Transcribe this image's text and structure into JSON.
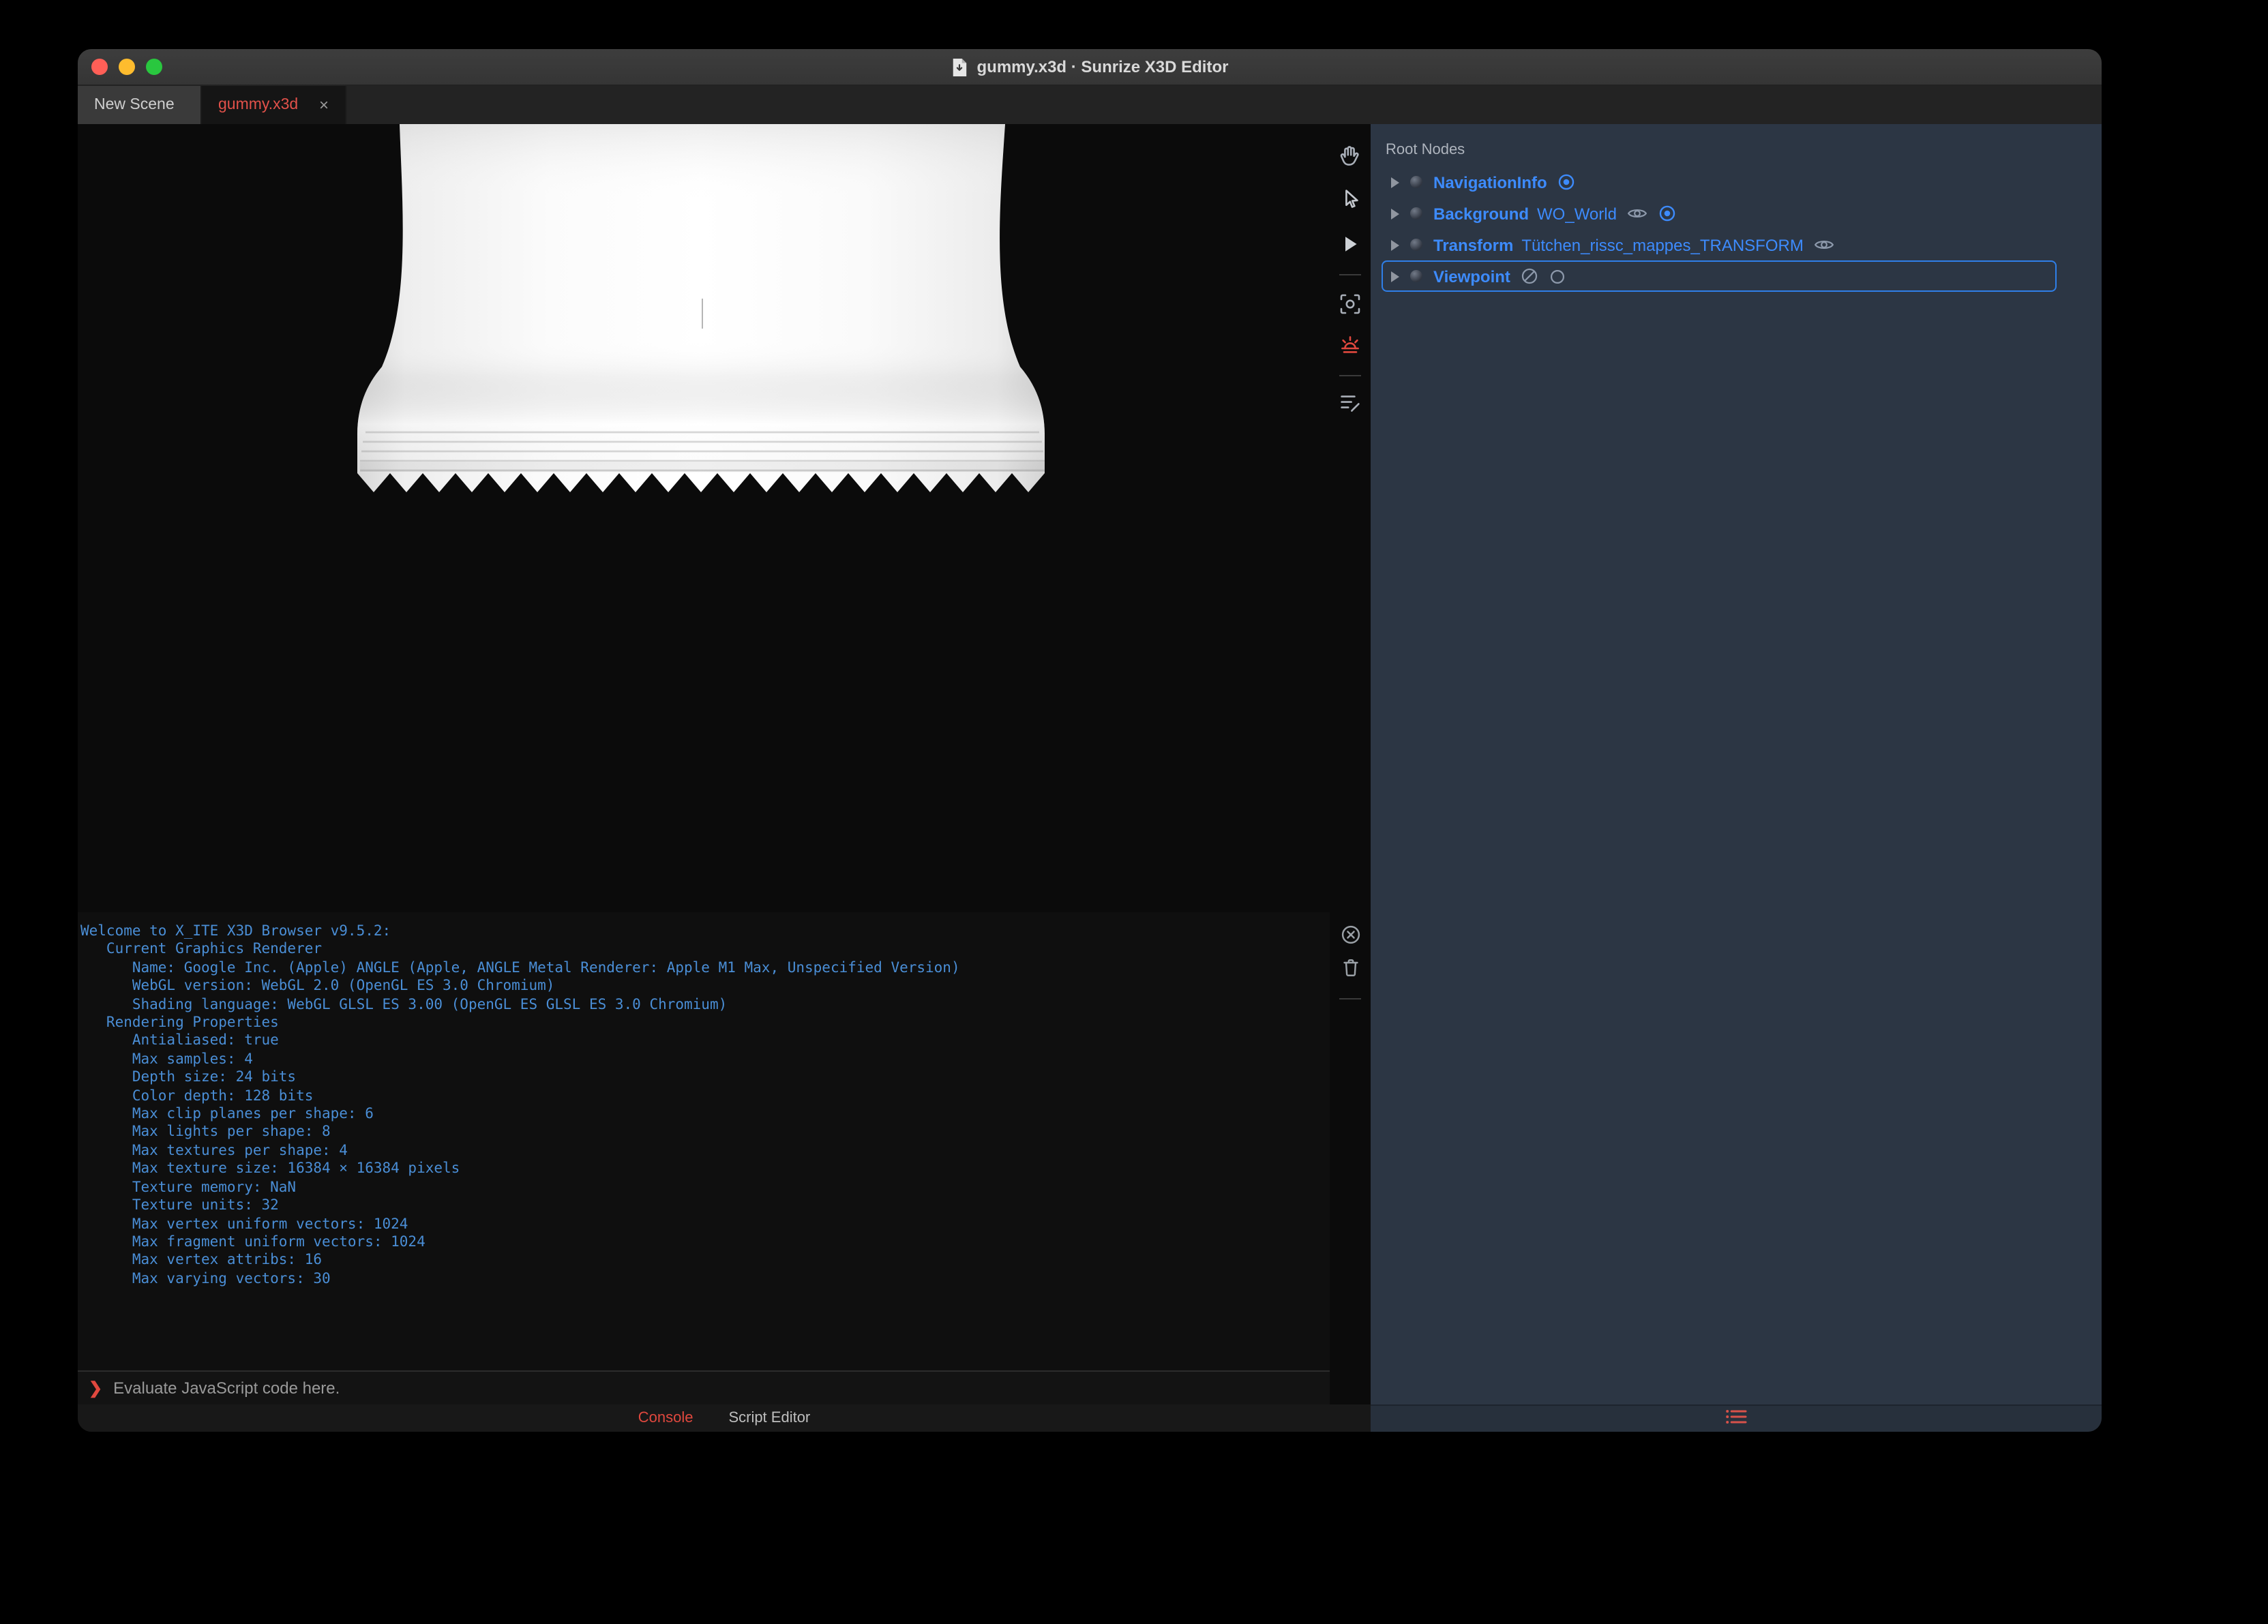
{
  "window": {
    "title": "gummy.x3d · Sunrize X3D Editor"
  },
  "tab_bar": {
    "tabs": [
      {
        "label": "New Scene",
        "active": false
      },
      {
        "label": "gummy.x3d",
        "active": true,
        "close": "×"
      }
    ]
  },
  "viewport_toolbar": {
    "icons": [
      "pan-hand",
      "select-arrow",
      "play",
      "snapshot",
      "sunrise-light",
      "script-notes",
      "clear-console",
      "delete-console"
    ]
  },
  "console": {
    "lines": [
      "Welcome to X_ITE X3D Browser v9.5.2:",
      "   Current Graphics Renderer",
      "      Name: Google Inc. (Apple) ANGLE (Apple, ANGLE Metal Renderer: Apple M1 Max, Unspecified Version)",
      "      WebGL version: WebGL 2.0 (OpenGL ES 3.0 Chromium)",
      "      Shading language: WebGL GLSL ES 3.00 (OpenGL ES GLSL ES 3.0 Chromium)",
      "   Rendering Properties",
      "      Antialiased: true",
      "      Max samples: 4",
      "      Depth size: 24 bits",
      "      Color depth: 128 bits",
      "      Max clip planes per shape: 6",
      "      Max lights per shape: 8",
      "      Max textures per shape: 4",
      "      Max texture size: 16384 × 16384 pixels",
      "      Texture memory: NaN",
      "      Texture units: 32",
      "      Max vertex uniform vectors: 1024",
      "      Max fragment uniform vectors: 1024",
      "      Max vertex attribs: 16",
      "      Max varying vectors: 30"
    ],
    "prompt": "❯",
    "placeholder": "Evaluate JavaScript code here.",
    "footer_tabs": [
      {
        "label": "Console",
        "active": true
      },
      {
        "label": "Script Editor",
        "active": false
      }
    ]
  },
  "outline": {
    "header": "Root Nodes",
    "nodes": [
      {
        "type": "NavigationInfo",
        "name": "",
        "selected": false
      },
      {
        "type": "Background",
        "name": "WO_World",
        "selected": false
      },
      {
        "type": "Transform",
        "name": "Tütchen_rissc_mappes_TRANSFORM",
        "selected": false
      },
      {
        "type": "Viewpoint",
        "name": "",
        "selected": true
      }
    ]
  },
  "colors": {
    "accent_red": "#e0483e",
    "accent_blue": "#3d8bfd",
    "console_text": "#4a8ed6",
    "panel_bg": "#2c3644",
    "traffic_close": "#ff5f57",
    "traffic_minimize": "#febc2e",
    "traffic_zoom": "#29c73f"
  }
}
